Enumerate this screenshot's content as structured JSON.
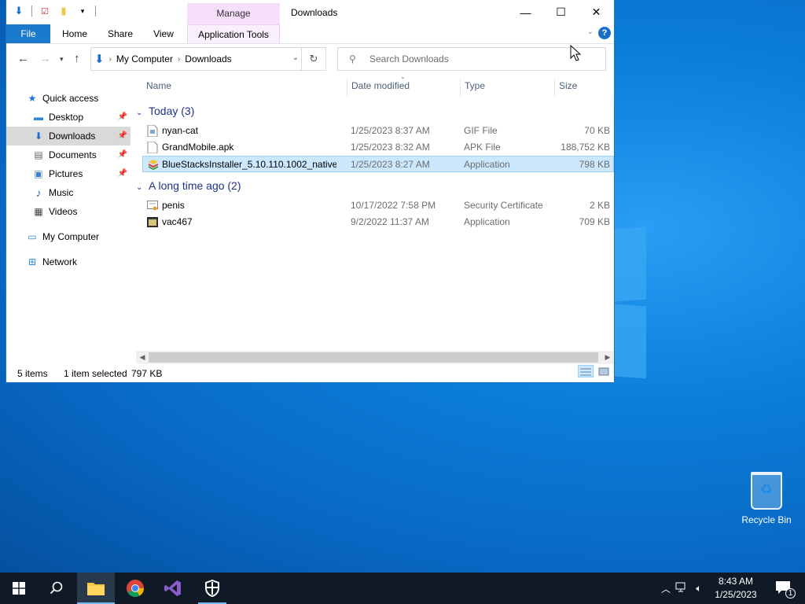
{
  "window": {
    "title": "Downloads",
    "manage_tab": "Manage",
    "controls": {
      "minimize": "—",
      "maximize": "☐",
      "close": "✕"
    }
  },
  "ribbon": {
    "tabs": [
      {
        "label": "File"
      },
      {
        "label": "Home"
      },
      {
        "label": "Share"
      },
      {
        "label": "View"
      },
      {
        "label": "Application Tools"
      }
    ],
    "help": "?"
  },
  "address": {
    "crumbs": [
      "My Computer",
      "Downloads"
    ],
    "search_placeholder": "Search Downloads"
  },
  "nav": {
    "items": [
      {
        "label": "Quick access",
        "icon": "star-icon",
        "glyph": "★",
        "color": "#1a73d9",
        "pinned": false,
        "selected": false
      },
      {
        "label": "Desktop",
        "icon": "desktop-icon",
        "glyph": "▬",
        "color": "#2a8be0",
        "pinned": true,
        "selected": false
      },
      {
        "label": "Downloads",
        "icon": "download-icon",
        "glyph": "⬇",
        "color": "#1b6fd1",
        "pinned": true,
        "selected": true
      },
      {
        "label": "Documents",
        "icon": "documents-icon",
        "glyph": "▤",
        "color": "#666",
        "pinned": true,
        "selected": false
      },
      {
        "label": "Pictures",
        "icon": "pictures-icon",
        "glyph": "▣",
        "color": "#3d7fc8",
        "pinned": true,
        "selected": false
      },
      {
        "label": "Music",
        "icon": "music-icon",
        "glyph": "♪",
        "color": "#2b6cb8",
        "pinned": false,
        "selected": false
      },
      {
        "label": "Videos",
        "icon": "videos-icon",
        "glyph": "▦",
        "color": "#444",
        "pinned": false,
        "selected": false
      },
      {
        "label": "My Computer",
        "icon": "computer-icon",
        "glyph": "▭",
        "color": "#2a8be0",
        "pinned": false,
        "selected": false
      },
      {
        "label": "Network",
        "icon": "network-icon",
        "glyph": "⊞",
        "color": "#2a8be0",
        "pinned": false,
        "selected": false
      }
    ]
  },
  "columns": {
    "name": "Name",
    "date": "Date modified",
    "type": "Type",
    "size": "Size"
  },
  "groups": [
    {
      "label": "Today (3)",
      "files": [
        {
          "name": "nyan-cat",
          "date": "1/25/2023 8:37 AM",
          "type": "GIF File",
          "size": "70 KB",
          "icon": "gif-file-icon",
          "selected": false
        },
        {
          "name": "GrandMobile.apk",
          "date": "1/25/2023 8:32 AM",
          "type": "APK File",
          "size": "188,752 KB",
          "icon": "apk-file-icon",
          "selected": false
        },
        {
          "name": "BlueStacksInstaller_5.10.110.1002_native_...",
          "date": "1/25/2023 8:27 AM",
          "type": "Application",
          "size": "798 KB",
          "icon": "bluestacks-icon",
          "selected": true
        }
      ]
    },
    {
      "label": "A long time ago (2)",
      "files": [
        {
          "name": "penis",
          "date": "10/17/2022 7:58 PM",
          "type": "Security Certificate",
          "size": "2 KB",
          "icon": "certificate-icon",
          "selected": false
        },
        {
          "name": "vac467",
          "date": "9/2/2022 11:37 AM",
          "type": "Application",
          "size": "709 KB",
          "icon": "application-icon",
          "selected": false
        }
      ]
    }
  ],
  "status": {
    "count": "5 items",
    "selected": "1 item selected",
    "size": "797 KB"
  },
  "desktop": {
    "recycle_bin": "Recycle Bin"
  },
  "taskbar": {
    "time": "8:43 AM",
    "date": "1/25/2023",
    "notifications": "1",
    "colors": {
      "background": "#101a27",
      "accent": "#76b9ed"
    }
  }
}
